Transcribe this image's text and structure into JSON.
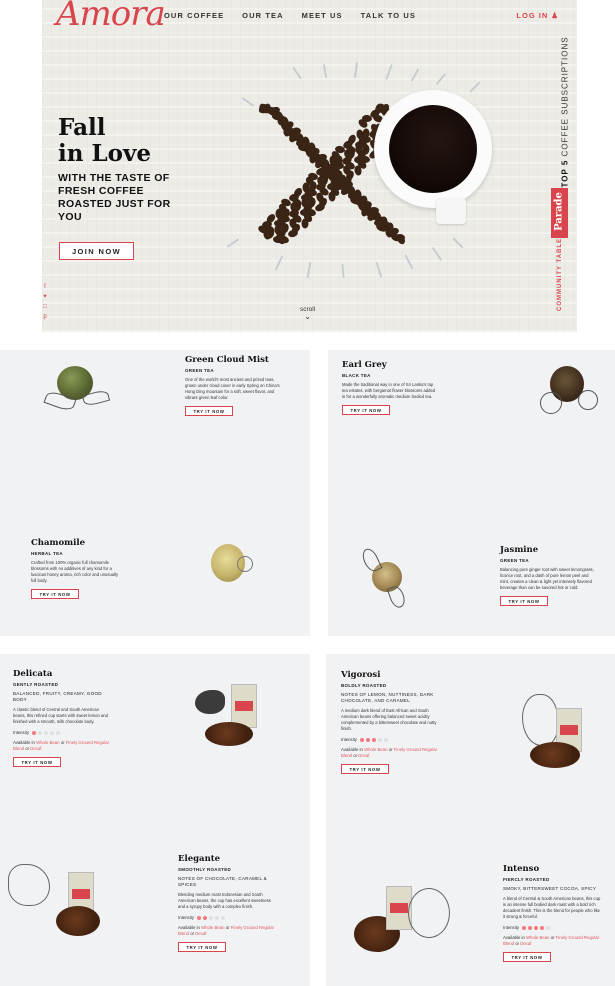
{
  "header": {
    "logo": "Amora",
    "nav": [
      "OUR COFFEE",
      "OUR TEA",
      "MEET US",
      "TALK TO US"
    ],
    "login": "LOG IN"
  },
  "hero": {
    "headline_line1": "Fall",
    "headline_line2": "in Love",
    "subhead": "WITH THE TASTE OF FRESH COFFEE ROASTED JUST FOR YOU",
    "cta": "JOIN NOW",
    "scroll": "scroll",
    "side_top": "TOP 5",
    "side_rest": "COFFEE SUBSCRIPTIONS",
    "parade": "Parade",
    "community": "COMMUNITY TABLE"
  },
  "teas": [
    {
      "name": "Green Cloud Mist",
      "type": "GREEN TEA",
      "desc": "One of the world's most ancient and prized teas, grown under cloud cover in early Spring on China's Hong Ding mountain for a soft, sweet flavor, and vibrant green leaf color.",
      "cta": "TRY IT NOW"
    },
    {
      "name": "Earl Grey",
      "type": "BLACK TEA",
      "desc": "Made the traditional way in one of Sri Lanka's top tea estates, with bergamot flower blossoms added in for a wonderfully aromatic medium bodied tea.",
      "cta": "TRY IT NOW"
    },
    {
      "name": "Chamomile",
      "type": "HERBAL TEA",
      "desc": "Crafted from 100% organic full chamomile blossoms with no additives of any kind for a luscious honey aroma, rich color and unusually full body.",
      "cta": "TRY IT NOW"
    },
    {
      "name": "Jasmine",
      "type": "GREEN TEA",
      "desc": "Balancing pure ginger root with sweet lemongrass, licorice root, and a dash of pure lemon peel and mint, creates a clean & light yet intensely flavored beverage than can be savored hot or cold.",
      "cta": "TRY IT NOW"
    }
  ],
  "coffees": [
    {
      "name": "Delicata",
      "roast": "GENTLY ROASTED",
      "notes": "BALANCED, FRUITY, CREAMY, GOOD BODY",
      "desc": "A classic blend of Central and South American beans, this refined cup starts with sweet lemon and finished with a smooth, milk chocolate body.",
      "intensity_label": "Intensity",
      "intensity": 1,
      "avail_prefix": "Available in",
      "avail_bean": "Whole Bean",
      "avail_or": "or",
      "avail_ground": "Finely Ground",
      "avail_regular": "Regular Blend",
      "avail_or2": "or",
      "avail_decaf": "Decaf",
      "cta": "TRY IT NOW"
    },
    {
      "name": "Vigorosi",
      "roast": "BOLDLY ROASTED",
      "notes": "NOTES OF LEMON, NUTTINESS, DARK CHOCOLATE, AND CARAMEL",
      "desc": "A medium dark blend of East African and South American beans offering balanced sweet acidity complemented by a bittersweet chocolate and nutty finish.",
      "intensity_label": "Intensity",
      "intensity": 3,
      "avail_prefix": "Available in",
      "avail_bean": "Whole Bean",
      "avail_or": "or",
      "avail_ground": "Finely Ground",
      "avail_regular": "Regular Blend",
      "avail_or2": "or",
      "avail_decaf": "Decaf",
      "cta": "TRY IT NOW"
    },
    {
      "name": "Elegante",
      "roast": "SMOOTHLY ROASTED",
      "notes": "NOTES OF CHOCOLATE, CARAMEL & SPICES",
      "desc": "Blending medium roast Indonesian and South American beans, the cup has excellent sweetness and a syrupy body with a complex finish.",
      "intensity_label": "Intensity",
      "intensity": 2,
      "avail_prefix": "Available in",
      "avail_bean": "Whole Bean",
      "avail_or": "or",
      "avail_ground": "Finely Ground",
      "avail_regular": "Regular Blend",
      "avail_or2": "or",
      "avail_decaf": "Decaf",
      "cta": "TRY IT NOW"
    },
    {
      "name": "Intenso",
      "roast": "FIERCLY ROASTED",
      "notes": "SMOKY, BITTERSWEET COCOA, SPICY",
      "desc": "A blend of Central & South American beans, this cup is an intense full bodied dark roast with a bold rich decadent finish. This is the blend for people who like it strong & forceful.",
      "intensity_label": "Intensity",
      "intensity": 4,
      "avail_prefix": "Available in",
      "avail_bean": "Whole Bean",
      "avail_or": "or",
      "avail_ground": "Finely Ground",
      "avail_regular": "Regular Blend",
      "avail_or2": "or",
      "avail_decaf": "Decaf",
      "cta": "TRY IT NOW"
    }
  ],
  "colors": {
    "accent": "#d9454c",
    "panel": "#f1f2f4",
    "dot_on": "#f27a7f"
  },
  "icons": [
    "facebook-icon",
    "twitter-icon",
    "instagram-icon",
    "pinterest-icon",
    "user-icon",
    "chevron-down-icon"
  ]
}
